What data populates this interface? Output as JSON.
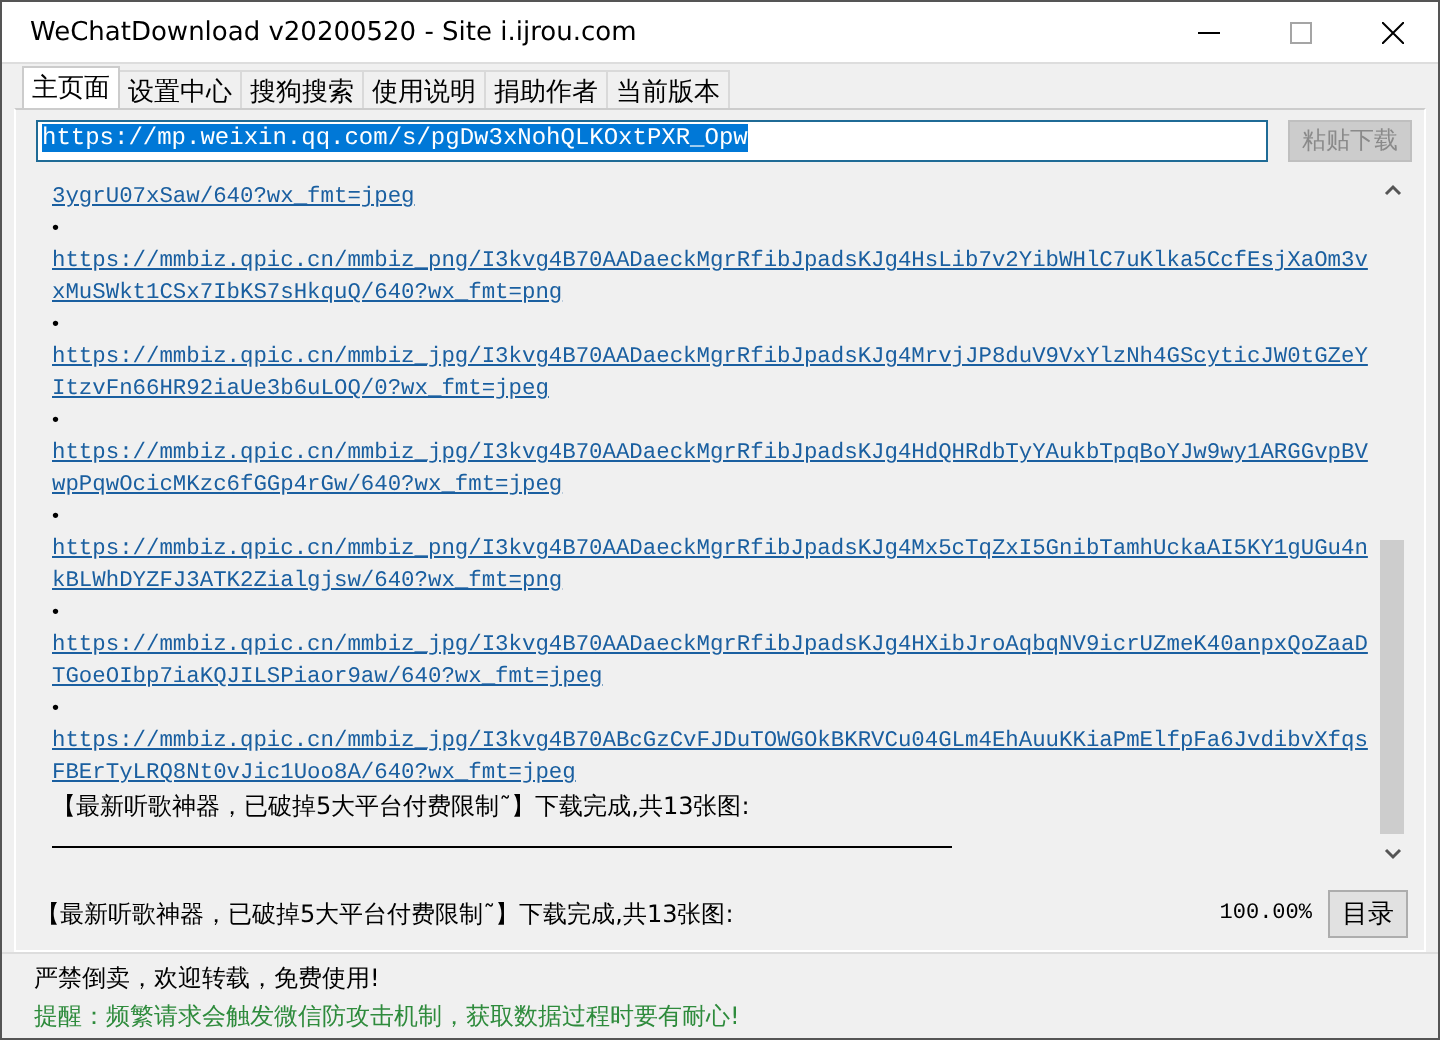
{
  "window": {
    "title": "WeChatDownload v20200520 - Site i.ijrou.com",
    "minimize_disabled": false,
    "maximize_disabled": true
  },
  "tabs": [
    {
      "label": "主页面",
      "selected": true
    },
    {
      "label": "设置中心",
      "selected": false
    },
    {
      "label": "搜狗搜索",
      "selected": false
    },
    {
      "label": "使用说明",
      "selected": false
    },
    {
      "label": "捐助作者",
      "selected": false
    },
    {
      "label": "当前版本",
      "selected": false
    }
  ],
  "url_field": {
    "value": "https://mp.weixin.qq.com/s/pgDw3xNohQLKOxtPXR_Opw",
    "selected": true
  },
  "paste_button": {
    "label": "粘贴下载",
    "disabled": true
  },
  "log": [
    {
      "kind": "link",
      "text": "3ygrU07xSaw/640?wx_fmt=jpeg"
    },
    {
      "kind": "bullet",
      "text": "•"
    },
    {
      "kind": "link",
      "text": "https://mmbiz.qpic.cn/mmbiz_png/I3kvg4B70AADaeckMgrRfibJpadsKJg4HsLib7v2YibWHlC7uKlka5CcfEsjXaOm3vxMuSWkt1CSx7IbKS7sHkquQ/640?wx_fmt=png"
    },
    {
      "kind": "bullet",
      "text": "•"
    },
    {
      "kind": "link",
      "text": "https://mmbiz.qpic.cn/mmbiz_jpg/I3kvg4B70AADaeckMgrRfibJpadsKJg4MrvjJP8duV9VxYlzNh4GScyticJW0tGZeYItzvFn66HR92iaUe3b6uLOQ/0?wx_fmt=jpeg"
    },
    {
      "kind": "bullet",
      "text": "•"
    },
    {
      "kind": "link",
      "text": "https://mmbiz.qpic.cn/mmbiz_jpg/I3kvg4B70AADaeckMgrRfibJpadsKJg4HdQHRdbTyYAukbTpqBoYJw9wy1ARGGvpBVwpPqwOcicMKzc6fGGp4rGw/640?wx_fmt=jpeg"
    },
    {
      "kind": "bullet",
      "text": "•"
    },
    {
      "kind": "link",
      "text": "https://mmbiz.qpic.cn/mmbiz_png/I3kvg4B70AADaeckMgrRfibJpadsKJg4Mx5cTqZxI5GnibTamhUckaAI5KY1gUGu4nkBLWhDYZFJ3ATK2Zialgjsw/640?wx_fmt=png"
    },
    {
      "kind": "bullet",
      "text": "•"
    },
    {
      "kind": "link",
      "text": "https://mmbiz.qpic.cn/mmbiz_jpg/I3kvg4B70AADaeckMgrRfibJpadsKJg4HXibJroAqbqNV9icrUZmeK40anpxQoZaaDTGoeOIbp7iaKQJILSPiaor9aw/640?wx_fmt=jpeg"
    },
    {
      "kind": "bullet",
      "text": "•"
    },
    {
      "kind": "link",
      "text": "https://mmbiz.qpic.cn/mmbiz_jpg/I3kvg4B70ABcGzCvFJDuTOWGOkBKRVCu04GLm4EhAuuKKiaPmElfpFa6JvdibvXfqsFBErTyLRQ8Nt0vJic1Uoo8A/640?wx_fmt=jpeg"
    },
    {
      "kind": "text",
      "text": "【最新听歌神器，已破掉5大平台付费限制˜】下载完成,共13张图:"
    },
    {
      "kind": "rule"
    }
  ],
  "status": {
    "text": "【最新听歌神器，已破掉5大平台付费限制˜】下载完成,共13张图:",
    "progress": "100.00%"
  },
  "catalog_button": {
    "label": "目录"
  },
  "footer": [
    {
      "text": "严禁倒卖，欢迎转载，免费使用!",
      "kind": "normal"
    },
    {
      "text": "提醒：频繁请求会触发微信防攻击机制，获取数据过程时要有耐心!",
      "kind": "notice"
    }
  ]
}
